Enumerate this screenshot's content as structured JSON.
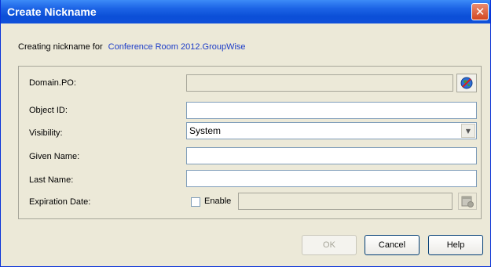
{
  "window": {
    "title": "Create Nickname",
    "close_glyph": "✕"
  },
  "header": {
    "prefix": "Creating nickname for",
    "target": "Conference Room 2012.GroupWise"
  },
  "form": {
    "domain_po": {
      "label": "Domain.PO:",
      "value": ""
    },
    "object_id": {
      "label": "Object ID:",
      "value": ""
    },
    "visibility": {
      "label": "Visibility:",
      "value": "System"
    },
    "given_name": {
      "label": "Given Name:",
      "value": ""
    },
    "last_name": {
      "label": "Last Name:",
      "value": ""
    },
    "expiration_date": {
      "label": "Expiration Date:",
      "enable_label": "Enable",
      "enabled": false,
      "value": ""
    }
  },
  "buttons": {
    "ok": "OK",
    "cancel": "Cancel",
    "help": "Help"
  },
  "icons": {
    "domain_lookup": "globe-icon",
    "calendar": "calendar-icon",
    "dropdown": "chevron-down-icon",
    "close": "close-icon"
  },
  "colors": {
    "title_bar": "#0B4FD7",
    "link": "#1C3CC8",
    "close_button": "#D4471F",
    "dialog_bg": "#ECE9D8"
  }
}
